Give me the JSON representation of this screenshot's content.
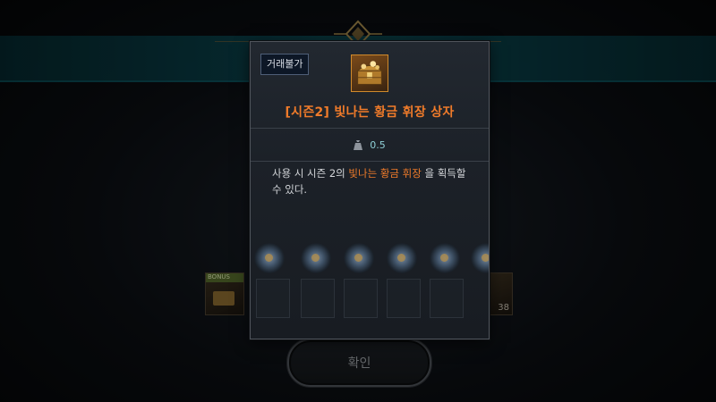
{
  "tooltip": {
    "trade_badge": "거래불가",
    "item_name": "[시즌2] 빛나는 황금 휘장 상자",
    "weight_value": "0.5",
    "description_prefix": "사용 시 시즌 2의 ",
    "description_highlight": "빛나는 황금 휘장",
    "description_suffix": " 을 획득할 수 있다.",
    "name_color": "#f07b2a"
  },
  "background": {
    "confirm_label": "확인",
    "bonus_label": "BONUS",
    "right_slot_count": "38"
  },
  "icons": {
    "item": "golden-treasure-chest-icon",
    "weight": "weight-bag-icon"
  }
}
